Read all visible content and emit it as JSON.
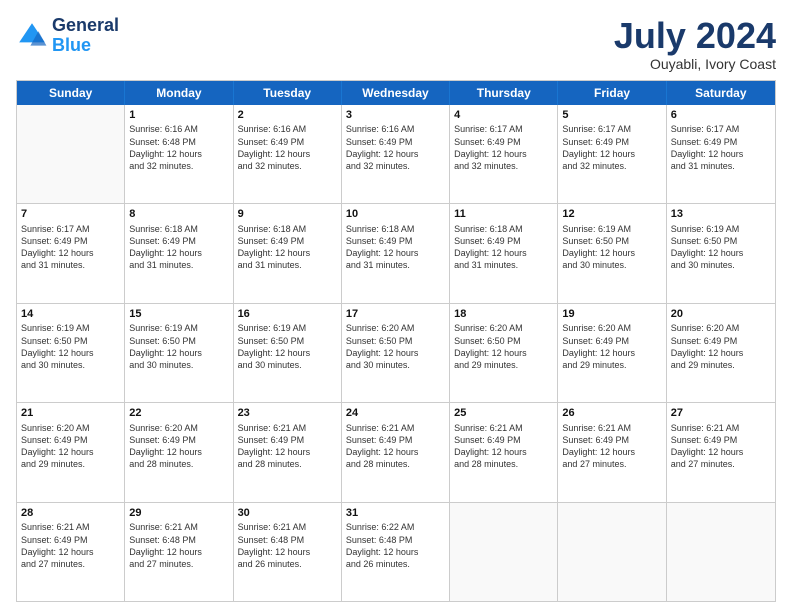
{
  "header": {
    "logo": {
      "line1": "General",
      "line2": "Blue"
    },
    "title": "July 2024",
    "location": "Ouyabli, Ivory Coast"
  },
  "days": [
    "Sunday",
    "Monday",
    "Tuesday",
    "Wednesday",
    "Thursday",
    "Friday",
    "Saturday"
  ],
  "weeks": [
    [
      {
        "day": "",
        "info": ""
      },
      {
        "day": "1",
        "info": "Sunrise: 6:16 AM\nSunset: 6:48 PM\nDaylight: 12 hours\nand 32 minutes."
      },
      {
        "day": "2",
        "info": "Sunrise: 6:16 AM\nSunset: 6:49 PM\nDaylight: 12 hours\nand 32 minutes."
      },
      {
        "day": "3",
        "info": "Sunrise: 6:16 AM\nSunset: 6:49 PM\nDaylight: 12 hours\nand 32 minutes."
      },
      {
        "day": "4",
        "info": "Sunrise: 6:17 AM\nSunset: 6:49 PM\nDaylight: 12 hours\nand 32 minutes."
      },
      {
        "day": "5",
        "info": "Sunrise: 6:17 AM\nSunset: 6:49 PM\nDaylight: 12 hours\nand 32 minutes."
      },
      {
        "day": "6",
        "info": "Sunrise: 6:17 AM\nSunset: 6:49 PM\nDaylight: 12 hours\nand 31 minutes."
      }
    ],
    [
      {
        "day": "7",
        "info": "Sunrise: 6:17 AM\nSunset: 6:49 PM\nDaylight: 12 hours\nand 31 minutes."
      },
      {
        "day": "8",
        "info": "Sunrise: 6:18 AM\nSunset: 6:49 PM\nDaylight: 12 hours\nand 31 minutes."
      },
      {
        "day": "9",
        "info": "Sunrise: 6:18 AM\nSunset: 6:49 PM\nDaylight: 12 hours\nand 31 minutes."
      },
      {
        "day": "10",
        "info": "Sunrise: 6:18 AM\nSunset: 6:49 PM\nDaylight: 12 hours\nand 31 minutes."
      },
      {
        "day": "11",
        "info": "Sunrise: 6:18 AM\nSunset: 6:49 PM\nDaylight: 12 hours\nand 31 minutes."
      },
      {
        "day": "12",
        "info": "Sunrise: 6:19 AM\nSunset: 6:50 PM\nDaylight: 12 hours\nand 30 minutes."
      },
      {
        "day": "13",
        "info": "Sunrise: 6:19 AM\nSunset: 6:50 PM\nDaylight: 12 hours\nand 30 minutes."
      }
    ],
    [
      {
        "day": "14",
        "info": "Sunrise: 6:19 AM\nSunset: 6:50 PM\nDaylight: 12 hours\nand 30 minutes."
      },
      {
        "day": "15",
        "info": "Sunrise: 6:19 AM\nSunset: 6:50 PM\nDaylight: 12 hours\nand 30 minutes."
      },
      {
        "day": "16",
        "info": "Sunrise: 6:19 AM\nSunset: 6:50 PM\nDaylight: 12 hours\nand 30 minutes."
      },
      {
        "day": "17",
        "info": "Sunrise: 6:20 AM\nSunset: 6:50 PM\nDaylight: 12 hours\nand 30 minutes."
      },
      {
        "day": "18",
        "info": "Sunrise: 6:20 AM\nSunset: 6:50 PM\nDaylight: 12 hours\nand 29 minutes."
      },
      {
        "day": "19",
        "info": "Sunrise: 6:20 AM\nSunset: 6:49 PM\nDaylight: 12 hours\nand 29 minutes."
      },
      {
        "day": "20",
        "info": "Sunrise: 6:20 AM\nSunset: 6:49 PM\nDaylight: 12 hours\nand 29 minutes."
      }
    ],
    [
      {
        "day": "21",
        "info": "Sunrise: 6:20 AM\nSunset: 6:49 PM\nDaylight: 12 hours\nand 29 minutes."
      },
      {
        "day": "22",
        "info": "Sunrise: 6:20 AM\nSunset: 6:49 PM\nDaylight: 12 hours\nand 28 minutes."
      },
      {
        "day": "23",
        "info": "Sunrise: 6:21 AM\nSunset: 6:49 PM\nDaylight: 12 hours\nand 28 minutes."
      },
      {
        "day": "24",
        "info": "Sunrise: 6:21 AM\nSunset: 6:49 PM\nDaylight: 12 hours\nand 28 minutes."
      },
      {
        "day": "25",
        "info": "Sunrise: 6:21 AM\nSunset: 6:49 PM\nDaylight: 12 hours\nand 28 minutes."
      },
      {
        "day": "26",
        "info": "Sunrise: 6:21 AM\nSunset: 6:49 PM\nDaylight: 12 hours\nand 27 minutes."
      },
      {
        "day": "27",
        "info": "Sunrise: 6:21 AM\nSunset: 6:49 PM\nDaylight: 12 hours\nand 27 minutes."
      }
    ],
    [
      {
        "day": "28",
        "info": "Sunrise: 6:21 AM\nSunset: 6:49 PM\nDaylight: 12 hours\nand 27 minutes."
      },
      {
        "day": "29",
        "info": "Sunrise: 6:21 AM\nSunset: 6:48 PM\nDaylight: 12 hours\nand 27 minutes."
      },
      {
        "day": "30",
        "info": "Sunrise: 6:21 AM\nSunset: 6:48 PM\nDaylight: 12 hours\nand 26 minutes."
      },
      {
        "day": "31",
        "info": "Sunrise: 6:22 AM\nSunset: 6:48 PM\nDaylight: 12 hours\nand 26 minutes."
      },
      {
        "day": "",
        "info": ""
      },
      {
        "day": "",
        "info": ""
      },
      {
        "day": "",
        "info": ""
      }
    ]
  ]
}
